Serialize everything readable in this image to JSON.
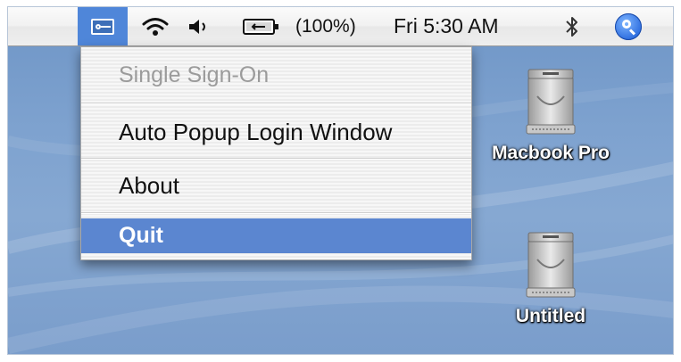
{
  "menubar": {
    "battery_text": "(100%)",
    "clock": "Fri 5:30 AM",
    "icons": [
      "single-sign-on-icon",
      "wifi-icon",
      "volume-icon",
      "battery-icon",
      "bluetooth-icon",
      "spotlight-icon"
    ]
  },
  "dropdown": {
    "title": "Single Sign-On",
    "items": [
      {
        "label": "Auto Popup Login Window"
      },
      {
        "label": "About"
      },
      {
        "label": "Quit"
      }
    ],
    "highlight_color": "#5b86d0"
  },
  "desktop": {
    "drives": [
      {
        "label": "Macbook Pro"
      },
      {
        "label": "Untitled"
      }
    ],
    "background_color": "#7ea2cf"
  }
}
